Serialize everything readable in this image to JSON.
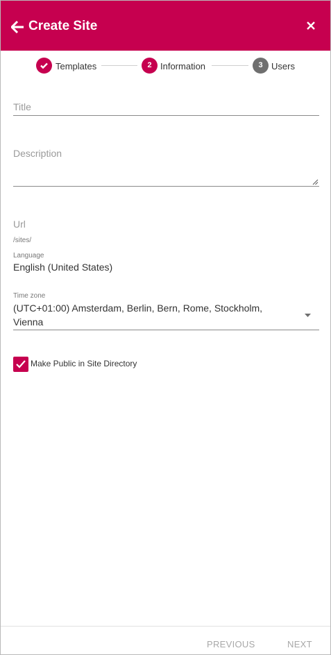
{
  "header": {
    "title": "Create Site",
    "back_icon": "arrow-left-icon",
    "close_icon": "close-icon"
  },
  "stepper": {
    "steps": [
      {
        "number": "",
        "label": "Templates",
        "state": "done"
      },
      {
        "number": "2",
        "label": "Information",
        "state": "active"
      },
      {
        "number": "3",
        "label": "Users",
        "state": "pending"
      }
    ]
  },
  "form": {
    "title_placeholder": "Title",
    "description_placeholder": "Description",
    "url_placeholder": "Url",
    "url_prefix": "/sites/",
    "language_label": "Language",
    "language_value": "English (United States)",
    "timezone_label": "Time zone",
    "timezone_value_line1": "(UTC+01:00) Amsterdam, Berlin, Bern, Rome, Stockholm,",
    "timezone_value_line2": "Vienna",
    "make_public_label": "Make Public in Site Directory",
    "make_public_checked": true
  },
  "footer": {
    "previous_label": "PREVIOUS",
    "next_label": "NEXT"
  },
  "colors": {
    "accent": "#c6004f",
    "step_pending": "#6f6f6f"
  }
}
